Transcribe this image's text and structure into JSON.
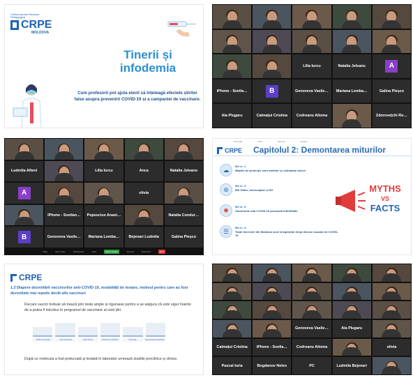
{
  "slide_title": {
    "logo": "CRPE",
    "logo_small": "Centrul pentru Resurse Pedagogice",
    "logo_sub": "MOLDOVA",
    "title": "Tinerii și infodemia",
    "subtitle": "Cum profesorii pot ajuta elevii să înțeleagă efectele știrilor false asupra prevenirii COVID-19 și a campaniei de vaccinare."
  },
  "grid1": {
    "tiles": [
      "",
      "",
      "",
      "",
      "",
      "",
      "",
      "",
      "",
      "",
      "",
      "",
      "Lilia Iurcu",
      "Natalia Jeleanu",
      "A",
      "iPhone - Svetla…",
      "B",
      "Genoveva Vasile…",
      "Mariana Lemba…",
      "Galina Pleșco",
      "Ala Plugaru",
      "Calmațui Cristina",
      "Codreanu Alioma",
      "",
      "Zdorovețchi Ro…"
    ]
  },
  "grid2": {
    "tiles": [
      "",
      "",
      "",
      "",
      "",
      "Ludmila Afteni",
      "",
      "Lilia Iurcu",
      "Anca",
      "Natalia Jeleanu",
      "A",
      "",
      "",
      "olivia",
      "",
      "",
      "iPhone - Svetlan…",
      "Popescius Anast…",
      "",
      "Natalia Condur…",
      "B",
      "Genoveva Vasile…",
      "Mariana Lemba…",
      "Bejenari Ludmila",
      "Galina Pleșco"
    ],
    "toolbar": [
      "Mute",
      "Stop Video",
      "Participants",
      "Chat",
      "Share Screen",
      "Record",
      "Reactions",
      "End"
    ]
  },
  "slide_myths": {
    "nav": [
      "Informații",
      "Ghid",
      "Resurse",
      "Despre"
    ],
    "chapter_title": "Capitolul 2: Demontarea miturilor",
    "myths": [
      {
        "head": "Mit nr. 1:",
        "text": "Măștile de protecție sunt otrăvite cu substanțe toxice"
      },
      {
        "head": "Mit nr. 2:",
        "text": "Bill Gates, microcipare și 5G"
      },
      {
        "head": "Mit nr. 3:",
        "text": "Vaccinurile anti-COVID-19 provoacă infertilitate"
      },
      {
        "head": "Mit nr. 4:",
        "text": "Toate decesele din Moldova sunt înregistrate drept decese cauzate de COVID-19"
      }
    ],
    "badge": [
      "MYTHS",
      "VS",
      "FACTS"
    ]
  },
  "slide_vaccine": {
    "logo": "CRPE",
    "heading": "1.3 Diapere dezvoltării vaccinurilor anti-COVID-19, modalități de testare, motivul pentru care au fost dezvoltate mai repede decât alte vaccinuri",
    "para1": "Fiecare vaccin trebuie să treacă prin teste ample și riguroase pentru a se asigura că este sigur înainte de a putea fi introdus în programul de vaccinare al unei țări.",
    "steps": [
      "Studii de laborator",
      "Faza preclinică",
      "Faza clinică",
      "Evaluare și aprobare",
      "Producție",
      "Monitorizarea siguranței"
    ],
    "para2": "După ce molecula a fost prelucrată și testată în laborator urmează studiile preclinice și clinice."
  },
  "grid3": {
    "tiles": [
      "",
      "",
      "",
      "",
      "",
      "",
      "",
      "",
      "",
      "",
      "",
      "",
      "",
      "",
      "",
      "",
      "",
      "Genoveva Vasile…",
      "Ala Plugaru",
      "",
      "Calmațui Cristina",
      "iPhone - Svetla…",
      "Codreanu Alioma",
      "",
      "olivia",
      "Pascal Iuria",
      "Bogdanov Neleo",
      "PC",
      "Ludmila Bejenari",
      ""
    ]
  },
  "colors": {
    "accent_blue": "#2a6ab5",
    "end_red": "#e0393e",
    "myths_red": "#e23b3b",
    "facts_blue": "#1f63b5"
  }
}
